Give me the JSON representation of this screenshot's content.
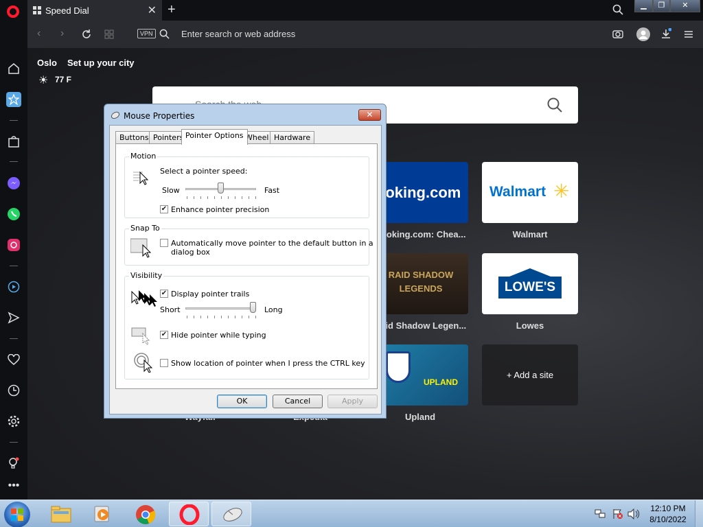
{
  "browser": {
    "tab_title": "Speed Dial",
    "address_placeholder": "Enter search or web address",
    "vpn_label": "VPN"
  },
  "weather": {
    "city": "Oslo",
    "setup_link": "Set up your city",
    "temperature": "77 F"
  },
  "search": {
    "placeholder": "Search the web"
  },
  "speed_dial": [
    {
      "name": "Booking.com",
      "label": "Booking.com: Chea..."
    },
    {
      "name": "Walmart",
      "label": "Walmart"
    },
    {
      "name": "RAID SHADOW LEGENDS",
      "label": "Raid Shadow Legen..."
    },
    {
      "name": "LOWE'S",
      "label": "Lowes"
    },
    {
      "name": "UPLAND",
      "label": "Upland"
    },
    {
      "name": "Add a site",
      "label": "+ Add a site"
    },
    {
      "label": "Wayfair"
    },
    {
      "label": "Expedia"
    }
  ],
  "dialog": {
    "title": "Mouse Properties",
    "tabs": [
      "Buttons",
      "Pointers",
      "Pointer Options",
      "Wheel",
      "Hardware"
    ],
    "active_tab": "Pointer Options",
    "motion": {
      "title": "Motion",
      "speed_label": "Select a pointer speed:",
      "slow": "Slow",
      "fast": "Fast",
      "speed_value_fraction": 0.5,
      "enhance_label": "Enhance pointer precision",
      "enhance_checked": true
    },
    "snap_to": {
      "title": "Snap To",
      "label_line1": "Automatically move pointer to the default button in a",
      "label_line2": "dialog box",
      "checked": false
    },
    "visibility": {
      "title": "Visibility",
      "trails_label": "Display pointer trails",
      "trails_checked": true,
      "short": "Short",
      "long": "Long",
      "trail_length_fraction": 1.0,
      "hide_label": "Hide pointer while typing",
      "hide_checked": true,
      "ctrl_label": "Show location of pointer when I press the CTRL key",
      "ctrl_checked": false
    },
    "buttons": {
      "ok": "OK",
      "cancel": "Cancel",
      "apply": "Apply"
    }
  },
  "taskbar": {
    "time": "12:10 PM",
    "date": "8/10/2022"
  },
  "colors": {
    "opera_red": "#ff1b2d",
    "booking_blue": "#003b95",
    "lowes_blue": "#004990",
    "walmart_blue": "#0071ce",
    "walmart_yellow": "#ffc220"
  }
}
